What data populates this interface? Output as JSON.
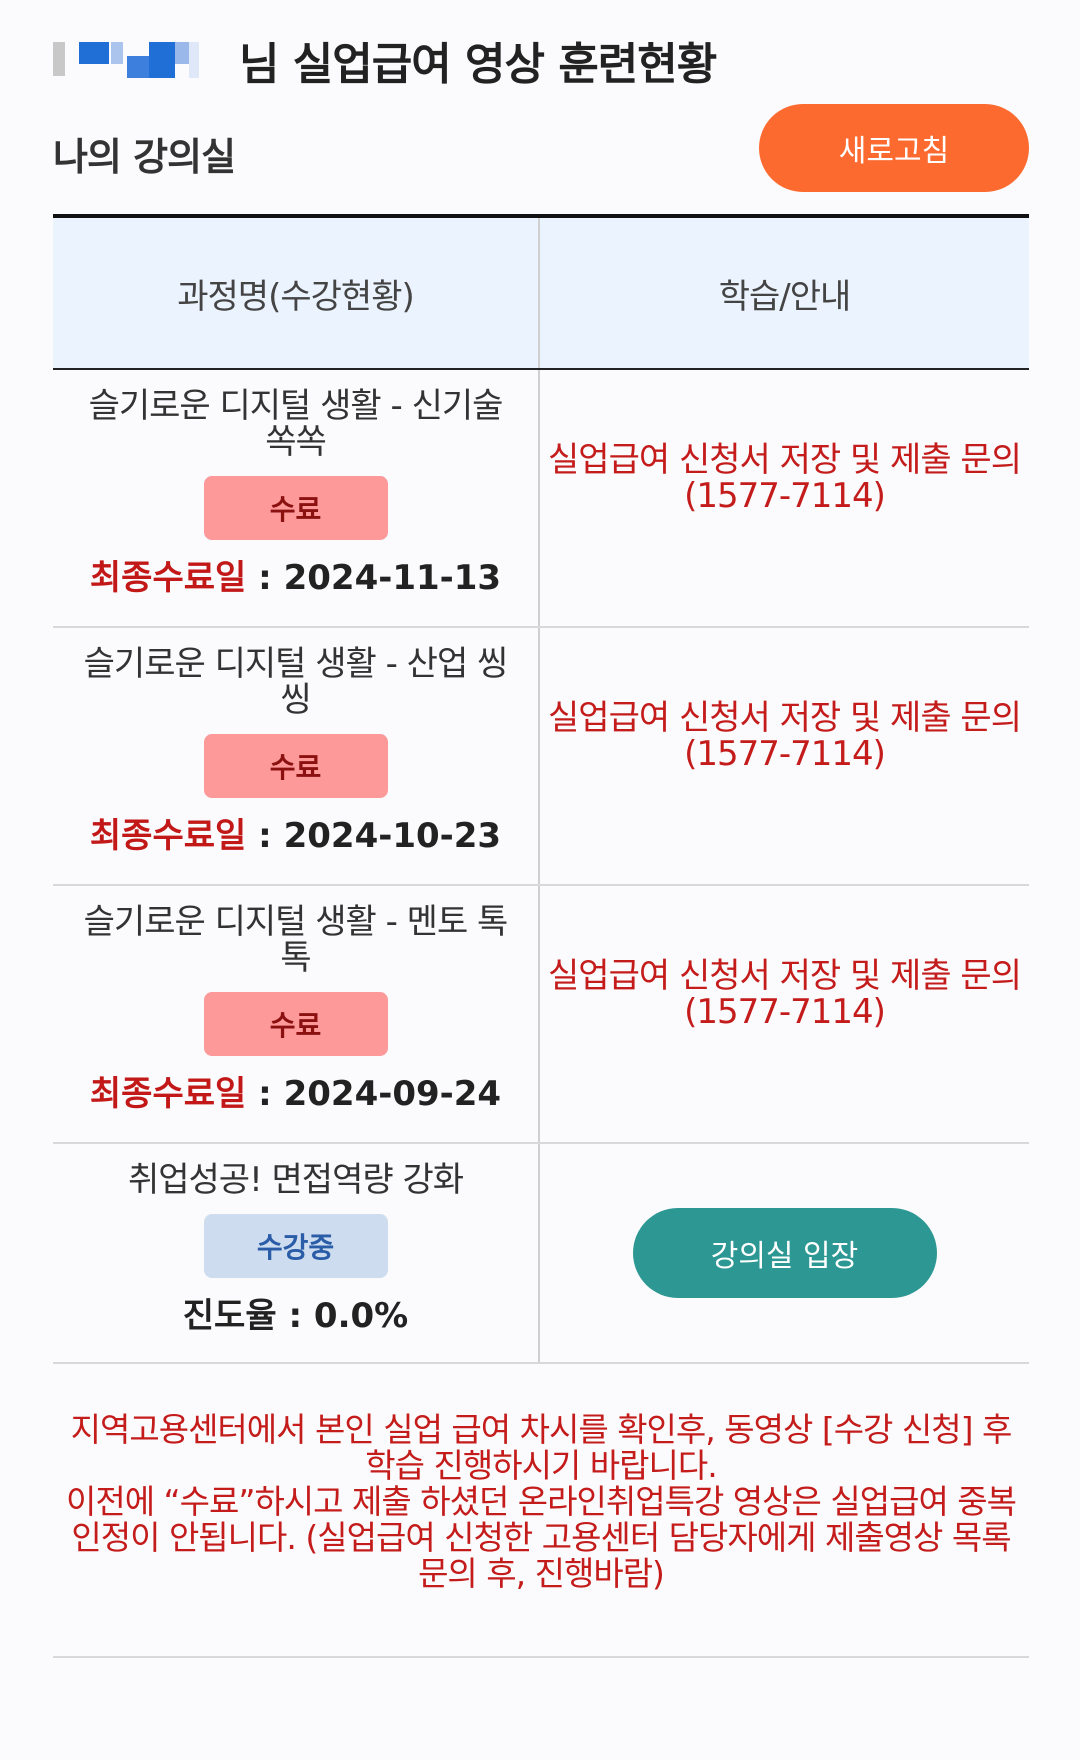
{
  "header": {
    "title": "님 실업급여 영상 훈련현황"
  },
  "classroom": {
    "title": "나의 강의실",
    "refresh_label": "새로고침"
  },
  "table": {
    "headers": [
      "과정명(수강현황)",
      "학습/안내"
    ],
    "rows": [
      {
        "course": "슬기로운 디지털 생활 - 신기술 쏙쏙",
        "status": "수료",
        "label": "최종수료일",
        "value": "2024-11-13",
        "guide": "실업급여 신청서 저장 및 제출 문의 (1577-7114)"
      },
      {
        "course": "슬기로운 디지털 생활 - 산업 씽씽",
        "status": "수료",
        "label": "최종수료일",
        "value": "2024-10-23",
        "guide": "실업급여 신청서 저장 및 제출 문의 (1577-7114)"
      },
      {
        "course": "슬기로운 디지털 생활 - 멘토 톡톡",
        "status": "수료",
        "label": "최종수료일",
        "value": "2024-09-24",
        "guide": "실업급여 신청서 저장 및 제출 문의 (1577-7114)"
      },
      {
        "course": "취업성공! 면접역량 강화",
        "status": "수강중",
        "label": "진도율",
        "value": "0.0%",
        "button": "강의실 입장"
      }
    ]
  },
  "notice": {
    "line1": "지역고용센터에서 본인 실업 급여 차시를 확인후, 동영상 [수강 신청] 후 학습 진행하시기 바랍니다.",
    "line2": "이전에 “수료”하시고 제출 하셨던 온라인취업특강 영상은 실업급여 중복 인정이 안됩니다. (실업급여 신청한 고용센터 담당자에게 제출영상 목록 문의 후, 진행바람)"
  },
  "colors": {
    "refresh": "#fd6a2f",
    "enter": "#2d9893",
    "badge_complete": "#fe999a",
    "badge_studying": "#cddcee",
    "accent_red": "#c41b1b",
    "header_bg": "#ebf3fe"
  }
}
